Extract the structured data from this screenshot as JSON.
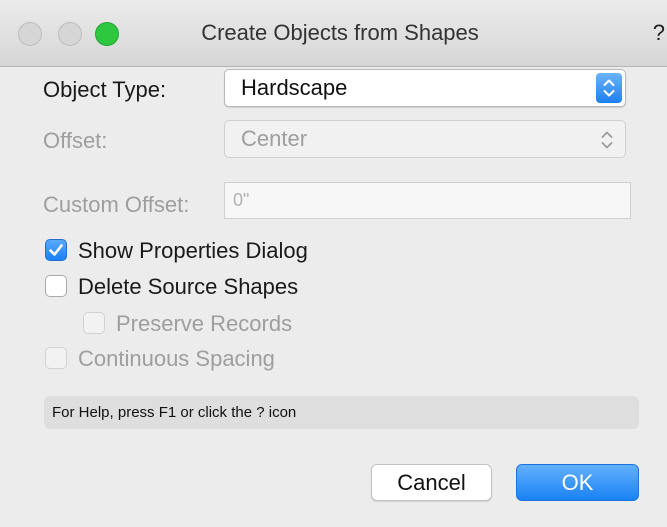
{
  "window": {
    "title": "Create Objects from Shapes",
    "help_glyph": "?"
  },
  "form": {
    "object_type_label": "Object Type:",
    "object_type_value": "Hardscape",
    "offset_label": "Offset:",
    "offset_value": "Center",
    "custom_offset_label": "Custom Offset:",
    "custom_offset_value": "0\""
  },
  "options": {
    "show_properties": {
      "label": "Show Properties Dialog",
      "checked": true,
      "enabled": true
    },
    "delete_source": {
      "label": "Delete Source Shapes",
      "checked": false,
      "enabled": true
    },
    "preserve_records": {
      "label": "Preserve Records",
      "checked": false,
      "enabled": false
    },
    "continuous_spacing": {
      "label": "Continuous Spacing",
      "checked": false,
      "enabled": false
    }
  },
  "help_text": "For Help, press F1 or click the ? icon",
  "buttons": {
    "cancel": "Cancel",
    "ok": "OK"
  },
  "colors": {
    "accent": "#1b7ff3",
    "close_dot": "#d6d6d6",
    "zoom_dot": "#2dc840"
  }
}
